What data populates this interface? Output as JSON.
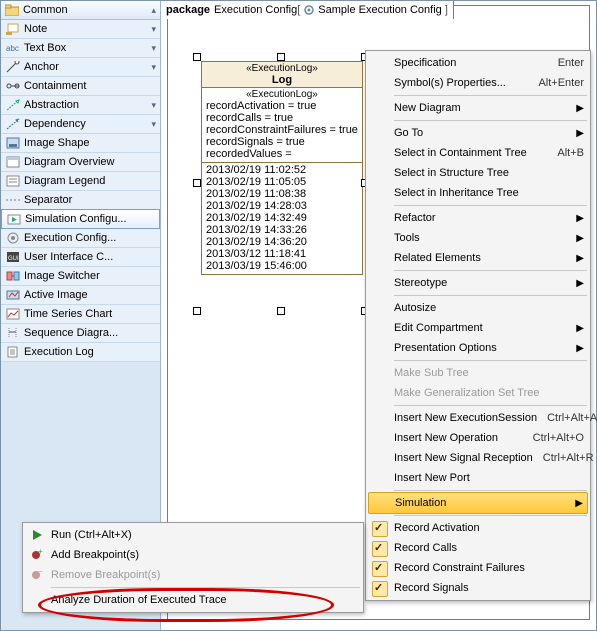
{
  "sidebar": {
    "header": "Common",
    "items": [
      {
        "label": "Note",
        "submenu": true
      },
      {
        "label": "Text Box",
        "submenu": true
      },
      {
        "label": "Anchor",
        "submenu": true
      },
      {
        "label": "Containment"
      },
      {
        "label": "Abstraction",
        "submenu": true
      },
      {
        "label": "Dependency",
        "submenu": true
      },
      {
        "label": "Image Shape"
      },
      {
        "label": "Diagram Overview"
      },
      {
        "label": "Diagram Legend"
      },
      {
        "label": "Separator",
        "special": "dashed"
      },
      {
        "label": "Simulation Configu...",
        "selected": true
      },
      {
        "label": "Execution Config..."
      },
      {
        "label": "User Interface C..."
      },
      {
        "label": "Image Switcher"
      },
      {
        "label": "Active Image"
      },
      {
        "label": "Time Series Chart"
      },
      {
        "label": "Sequence Diagra..."
      },
      {
        "label": "Execution Log"
      }
    ]
  },
  "package_tab": {
    "keyword": "package",
    "name": "Execution Config",
    "nested": "Sample Execution Config"
  },
  "element": {
    "stereotype": "«ExecutionLog»",
    "name": "Log",
    "attr_stereotype": "«ExecutionLog»",
    "attrs": [
      "recordActivation = true",
      "recordCalls = true",
      "recordConstraintFailures = true",
      "recordSignals = true",
      "recordedValues ="
    ],
    "ops": [
      "2013/02/19 11:02:52",
      "2013/02/19 11:05:05",
      "2013/02/19 11:08:38",
      "2013/02/19 14:28:03",
      "2013/02/19 14:32:49",
      "2013/02/19 14:33:26",
      "2013/02/19 14:36:20",
      "2013/03/12 11:18:41",
      "2013/03/19 15:46:00"
    ]
  },
  "context_menu": {
    "items": [
      {
        "label": "Specification",
        "accel": "Enter"
      },
      {
        "label": "Symbol(s) Properties...",
        "accel": "Alt+Enter"
      },
      {
        "sep": true
      },
      {
        "label": "New Diagram",
        "sub": true
      },
      {
        "sep": true
      },
      {
        "label": "Go To",
        "sub": true
      },
      {
        "label": "Select in Containment Tree",
        "accel": "Alt+B"
      },
      {
        "label": "Select in Structure Tree"
      },
      {
        "label": "Select in Inheritance Tree"
      },
      {
        "sep": true
      },
      {
        "label": "Refactor",
        "sub": true
      },
      {
        "label": "Tools",
        "sub": true
      },
      {
        "label": "Related Elements",
        "sub": true
      },
      {
        "sep": true
      },
      {
        "label": "Stereotype",
        "sub": true
      },
      {
        "sep": true
      },
      {
        "label": "Autosize"
      },
      {
        "label": "Edit Compartment",
        "sub": true
      },
      {
        "label": "Presentation Options",
        "sub": true
      },
      {
        "sep": true
      },
      {
        "label": "Make Sub Tree",
        "disabled": true
      },
      {
        "label": "Make Generalization Set Tree",
        "disabled": true
      },
      {
        "sep": true
      },
      {
        "label": "Insert New ExecutionSession",
        "accel": "Ctrl+Alt+A"
      },
      {
        "label": "Insert New Operation",
        "accel": "Ctrl+Alt+O"
      },
      {
        "label": "Insert New Signal Reception",
        "accel": "Ctrl+Alt+R"
      },
      {
        "label": "Insert New Port"
      },
      {
        "sep": true
      },
      {
        "label": "Simulation",
        "sub": true,
        "highlight": true
      },
      {
        "sep": true
      },
      {
        "label": "Record Activation",
        "check": true
      },
      {
        "label": "Record Calls",
        "check": true
      },
      {
        "label": "Record Constraint Failures",
        "check": true
      },
      {
        "label": "Record Signals",
        "check": true
      }
    ]
  },
  "bottom_menu": {
    "items": [
      {
        "label": "Run (Ctrl+Alt+X)",
        "icon": "play"
      },
      {
        "label": "Add Breakpoint(s)",
        "icon": "bp-add"
      },
      {
        "label": "Remove Breakpoint(s)",
        "icon": "bp-rem",
        "disabled": true
      },
      {
        "sep": true
      },
      {
        "label": "Analyze Duration of Executed Trace"
      }
    ]
  }
}
